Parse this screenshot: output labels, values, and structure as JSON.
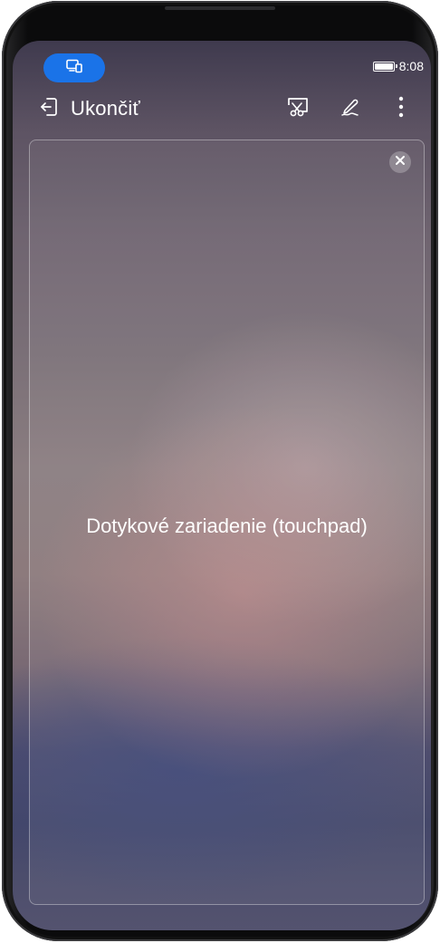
{
  "status_bar": {
    "time": "8:08",
    "cast_icon": "screen-projection-icon",
    "battery_icon": "battery-icon"
  },
  "toolbar": {
    "exit_label": "Ukončiť",
    "exit_icon": "exit-icon",
    "screenshot_icon": "screenshot-scissors-icon",
    "annotate_icon": "pen-icon",
    "more_icon": "more-vertical-icon"
  },
  "touchpad": {
    "label": "Dotykové zariadenie (touchpad)",
    "close_icon": "close-icon"
  },
  "colors": {
    "accent": "#1a73e8",
    "text": "#ffffff"
  }
}
